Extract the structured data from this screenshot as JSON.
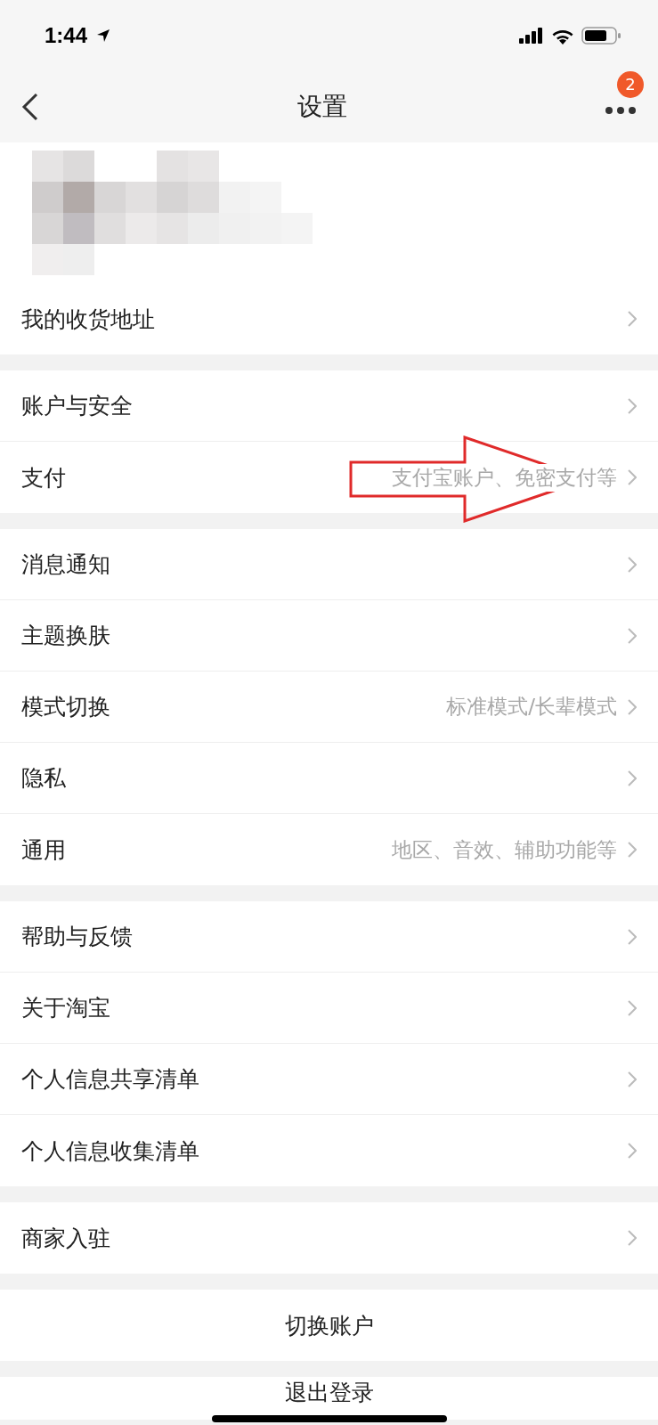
{
  "status_bar": {
    "time": "1:44"
  },
  "nav": {
    "title": "设置",
    "badge": "2"
  },
  "groups": [
    {
      "rows": [
        {
          "label": "我的收货地址"
        }
      ]
    },
    {
      "rows": [
        {
          "label": "账户与安全"
        },
        {
          "label": "支付",
          "hint": "支付宝账户、免密支付等"
        }
      ]
    },
    {
      "rows": [
        {
          "label": "消息通知"
        },
        {
          "label": "主题换肤"
        },
        {
          "label": "模式切换",
          "hint": "标准模式/长辈模式"
        },
        {
          "label": "隐私"
        },
        {
          "label": "通用",
          "hint": "地区、音效、辅助功能等"
        }
      ]
    },
    {
      "rows": [
        {
          "label": "帮助与反馈"
        },
        {
          "label": "关于淘宝"
        },
        {
          "label": "个人信息共享清单"
        },
        {
          "label": "个人信息收集清单"
        }
      ]
    },
    {
      "rows": [
        {
          "label": "商家入驻"
        }
      ]
    }
  ],
  "actions": [
    {
      "label": "切换账户"
    },
    {
      "label": "退出登录"
    }
  ]
}
